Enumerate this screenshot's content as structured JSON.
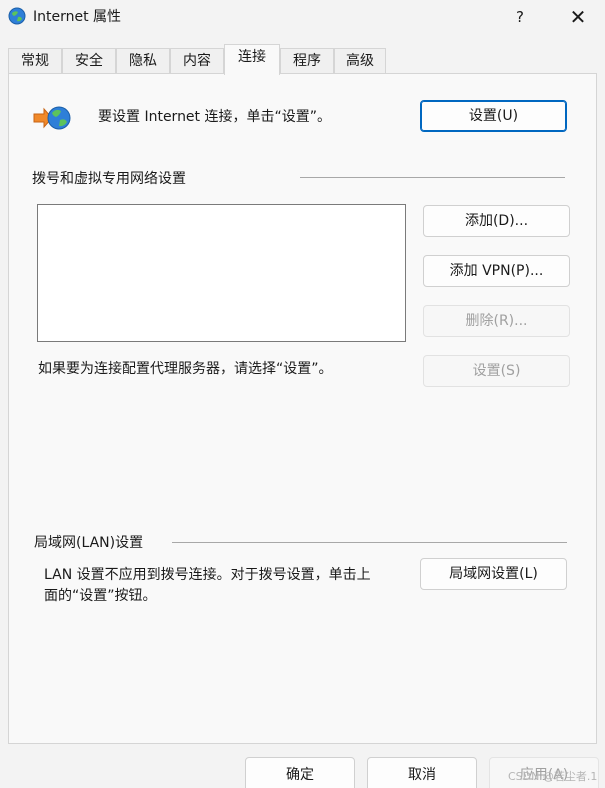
{
  "window": {
    "title": "Internet 属性",
    "help_label": "?",
    "close_label": "✕"
  },
  "tabs": [
    {
      "label": "常规"
    },
    {
      "label": "安全"
    },
    {
      "label": "隐私"
    },
    {
      "label": "内容"
    },
    {
      "label": "连接",
      "active": true
    },
    {
      "label": "程序"
    },
    {
      "label": "高级"
    }
  ],
  "connection": {
    "setup_text": "要设置 Internet 连接，单击“设置”。",
    "setup_button": "设置(U)"
  },
  "dialup": {
    "heading": "拨号和虚拟专用网络设置",
    "add_button": "添加(D)...",
    "add_vpn_button": "添加 VPN(P)...",
    "remove_button": "删除(R)...",
    "proxy_text": "如果要为连接配置代理服务器，请选择“设置”。",
    "settings_button": "设置(S)"
  },
  "lan": {
    "heading": "局域网(LAN)设置",
    "desc_line1": "LAN 设置不应用到拨号连接。对于拨号设置，单击上",
    "desc_line2": "面的“设置”按钮。",
    "lan_button": "局域网设置(L)"
  },
  "footer": {
    "ok": "确定",
    "cancel": "取消",
    "apply": "应用(A)"
  },
  "watermark": "CSDN @若尘者.1",
  "colors": {
    "accent": "#0067c0",
    "disabled_text": "#a0a0a0"
  }
}
